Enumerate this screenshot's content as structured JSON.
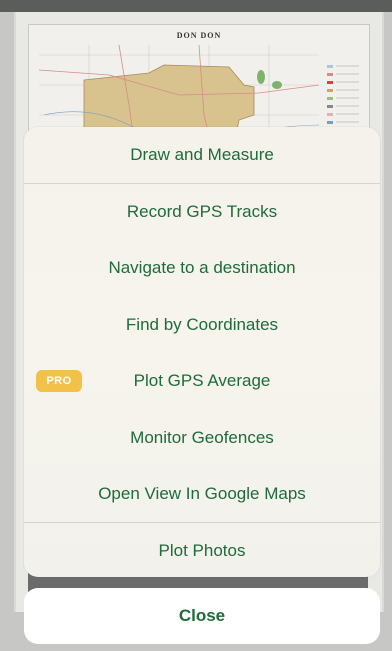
{
  "map": {
    "title": "DON DON"
  },
  "action_sheet": {
    "items": [
      {
        "label": "Draw and Measure"
      },
      {
        "label": "Record GPS Tracks"
      },
      {
        "label": "Navigate to a destination"
      },
      {
        "label": "Find by Coordinates"
      },
      {
        "label": "Plot GPS Average",
        "badge": "PRO"
      },
      {
        "label": "Monitor Geofences"
      },
      {
        "label": "Open View In Google Maps"
      },
      {
        "label": "Plot Photos"
      }
    ],
    "close_label": "Close"
  },
  "colors": {
    "action_text": "#1f6b3a",
    "pro_badge": "#f1c14a",
    "sheet_background": "#f4f2ea"
  }
}
